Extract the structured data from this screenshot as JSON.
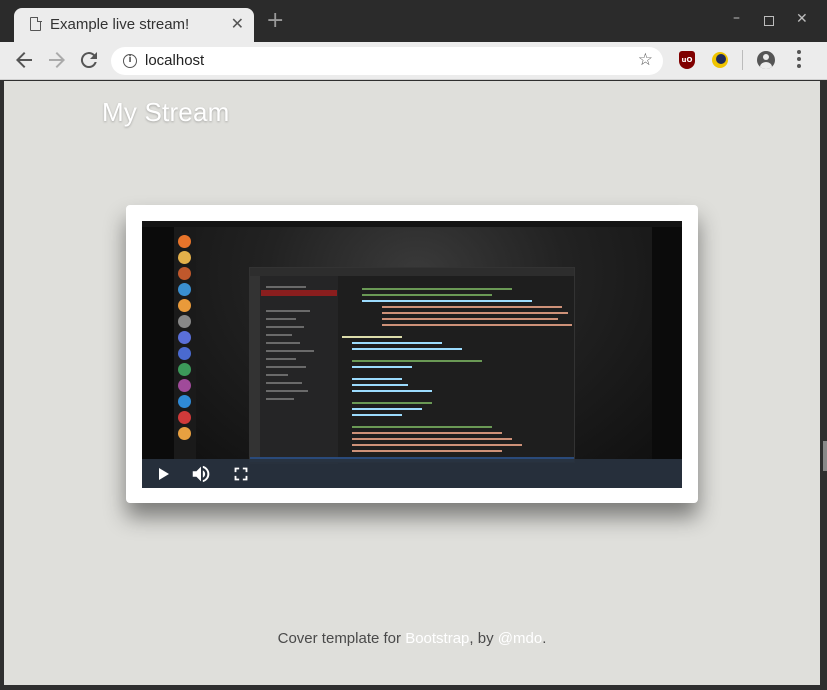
{
  "browser": {
    "tab_title": "Example live stream!",
    "tab_close": "✕",
    "new_tab": "+",
    "url": "localhost",
    "window_controls": {
      "minimize": "–",
      "close": "✕"
    },
    "icons": [
      "document-icon",
      "back-icon",
      "forward-icon",
      "reload-icon",
      "info-icon",
      "star-icon",
      "ublock-icon",
      "dark-reader-icon",
      "account-icon",
      "menu-icon"
    ]
  },
  "page": {
    "site_title": "My Stream",
    "footer": {
      "prefix": "Cover template for ",
      "link1": "Bootstrap",
      "middle": ", by ",
      "link2": "@mdo",
      "suffix": "."
    },
    "player": {
      "controls": [
        "play",
        "volume",
        "fullscreen"
      ]
    }
  },
  "colors": {
    "page_background": "#dfdfdb",
    "card_background": "#ffffff",
    "controls_bar": "#28323e",
    "ublock_red": "#800000"
  }
}
